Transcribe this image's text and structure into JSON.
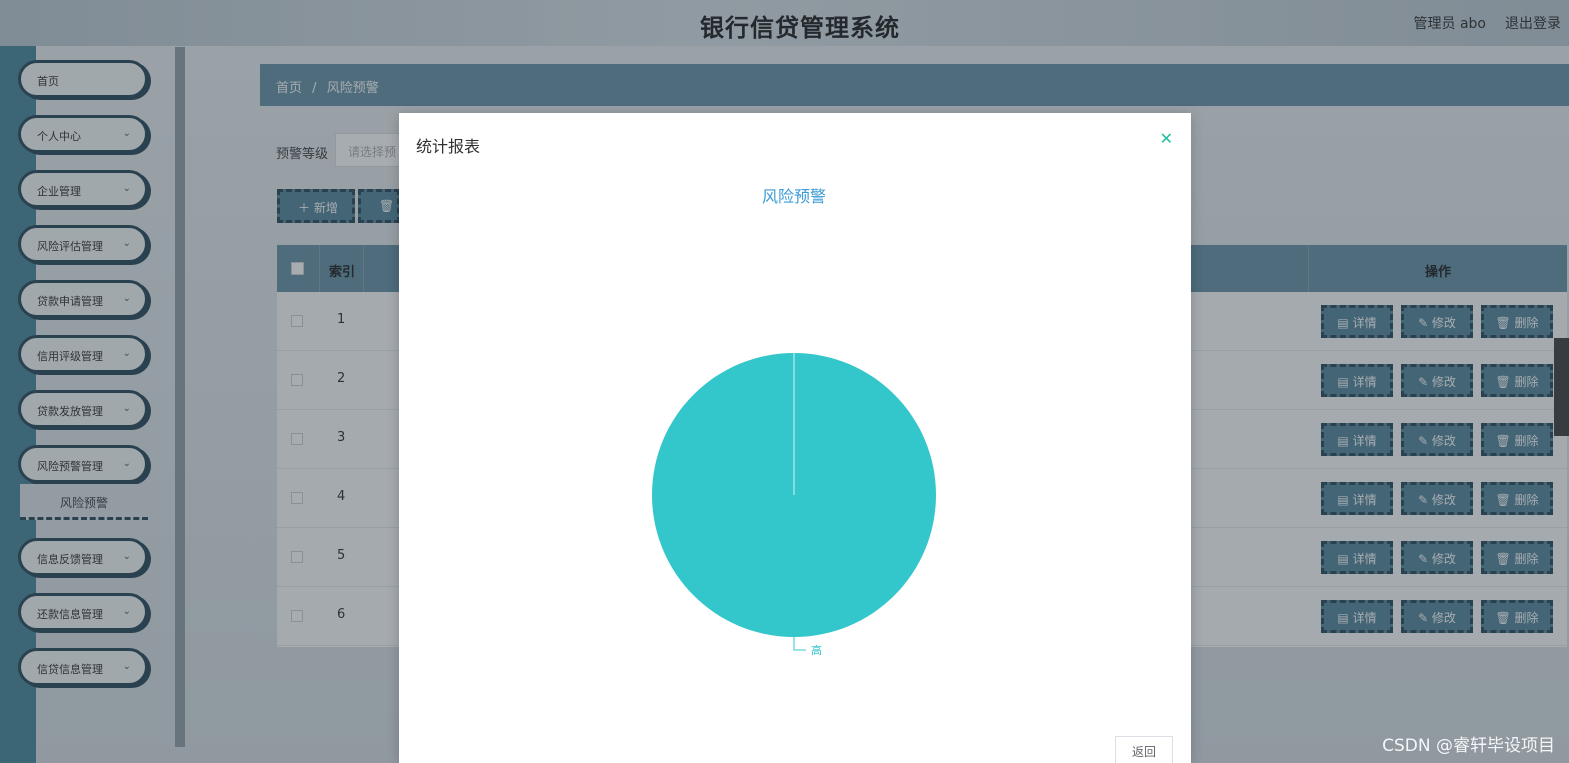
{
  "app": {
    "title": "银行信贷管理系统",
    "user_label": "管理员 abo",
    "logout_label": "退出登录"
  },
  "sidebar": {
    "items": [
      {
        "label": "首页",
        "has_arrow": false
      },
      {
        "label": "个人中心",
        "has_arrow": true
      },
      {
        "label": "企业管理",
        "has_arrow": true
      },
      {
        "label": "风险评估管理",
        "has_arrow": true
      },
      {
        "label": "贷款申请管理",
        "has_arrow": true
      },
      {
        "label": "信用评级管理",
        "has_arrow": true
      },
      {
        "label": "贷款发放管理",
        "has_arrow": true
      },
      {
        "label": "风险预警管理",
        "has_arrow": true
      },
      {
        "label": "信息反馈管理",
        "has_arrow": true
      },
      {
        "label": "还款信息管理",
        "has_arrow": true
      },
      {
        "label": "信贷信息管理",
        "has_arrow": true
      }
    ],
    "sub_item": "风险预警",
    "arrow_glyph": "⌄"
  },
  "breadcrumb": {
    "home": "首页",
    "separator": "/",
    "current": "风险预警"
  },
  "filter": {
    "label": "预警等级",
    "placeholder": "请选择预"
  },
  "toolbar": {
    "add_label": "＋ 新增",
    "delete_label": "🗑"
  },
  "table": {
    "headers": {
      "index": "索引",
      "actions": "操作"
    },
    "rows": [
      "1",
      "2",
      "3",
      "4",
      "5",
      "6"
    ],
    "actions": [
      "▤ 详情",
      "✎ 修改",
      "🗑 删除"
    ]
  },
  "modal": {
    "title": "统计报表",
    "close_glyph": "✕",
    "back_label": "返回"
  },
  "chart_data": {
    "type": "pie",
    "title": "风险预警",
    "categories": [
      "高"
    ],
    "values": [
      1
    ],
    "colors": {
      "slice": "#33c6cb",
      "title": "#3a9bd6",
      "label": "#33c6cb"
    }
  },
  "watermark": "CSDN @睿轩毕设项目"
}
